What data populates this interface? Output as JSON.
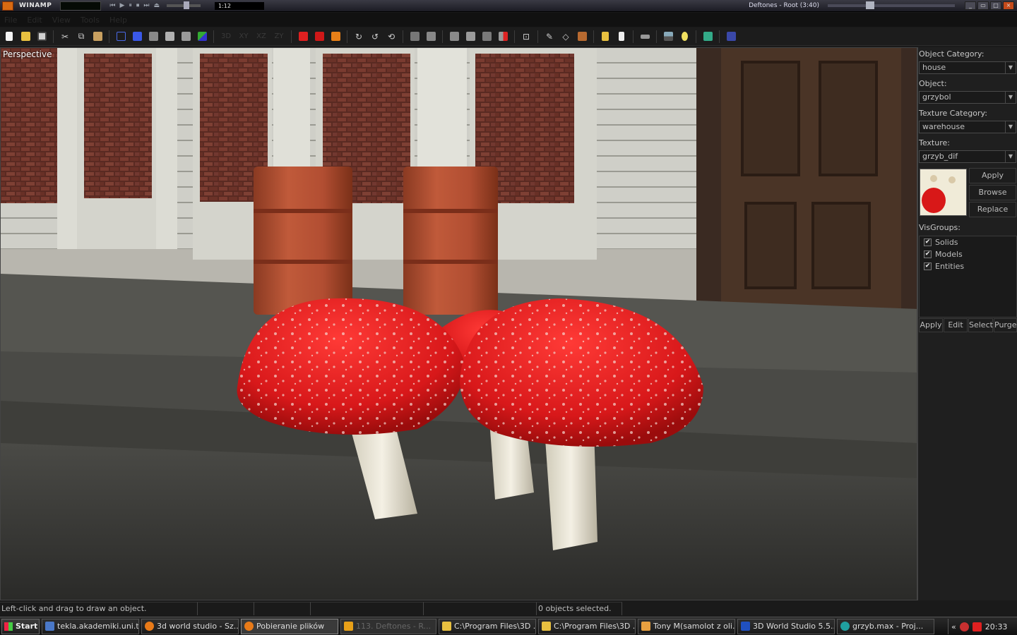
{
  "winamp": {
    "title": "WINAMP",
    "time": "1:12",
    "track": "Deftones - Root (3:40)",
    "controls": [
      "⏮",
      "▶",
      "⏸",
      "⏹",
      "⏭",
      "⏏"
    ]
  },
  "menu": [
    "File",
    "Edit",
    "View",
    "Tools",
    "Help"
  ],
  "viewport": {
    "label": "Perspective"
  },
  "sidebar": {
    "object_category_label": "Object Category:",
    "object_category_value": "house",
    "object_label": "Object:",
    "object_value": "grzybol",
    "texture_category_label": "Texture Category:",
    "texture_category_value": "warehouse",
    "texture_label": "Texture:",
    "texture_value": "grzyb_dif",
    "apply_label": "Apply",
    "browse_label": "Browse",
    "replace_label": "Replace",
    "visgroups_label": "VisGroups:",
    "visgroups": [
      {
        "name": "Solids",
        "checked": true
      },
      {
        "name": "Models",
        "checked": true
      },
      {
        "name": "Entities",
        "checked": true
      }
    ],
    "bottom_buttons": [
      "Apply",
      "Edit",
      "Select",
      "Purge"
    ]
  },
  "status": {
    "hint": "Left-click and drag to draw an object.",
    "selection": "0 objects selected."
  },
  "taskbar": {
    "start": "Start",
    "tasks": [
      {
        "label": "tekla.akademiki.uni.t...",
        "icon_color": "#4a78c8",
        "icon": "network-icon"
      },
      {
        "label": "3d world studio - Sz...",
        "icon_color": "#e87a18",
        "icon": "firefox-icon"
      },
      {
        "label": "Pobieranie plików",
        "icon_color": "#e87a18",
        "icon": "firefox-icon"
      },
      {
        "label": "113. Deftones - R...",
        "icon_color": "#e8a018",
        "icon": "winamp-icon"
      },
      {
        "label": "C:\\Program Files\\3D ...",
        "icon_color": "#e8c040",
        "icon": "folder-icon"
      },
      {
        "label": "C:\\Program Files\\3D ...",
        "icon_color": "#e8c040",
        "icon": "folder-icon"
      },
      {
        "label": "Tony M(samolot z oli...",
        "icon_color": "#e8a040",
        "icon": "mail-icon"
      },
      {
        "label": "3D World Studio 5.5...",
        "icon_color": "#2050c0",
        "icon": "app-icon"
      },
      {
        "label": "grzyb.max     - Proj...",
        "icon_color": "#20a0a0",
        "icon": "3dsmax-icon"
      }
    ],
    "clock": "20:33"
  }
}
